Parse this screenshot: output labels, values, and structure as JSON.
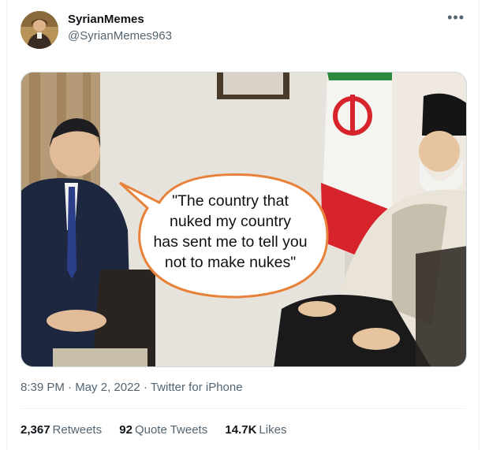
{
  "author": {
    "display_name": "SyrianMemes",
    "handle": "@SyrianMemes963",
    "avatar_icon": "user-avatar"
  },
  "more_icon": "more-options-icon",
  "image": {
    "caption_lines": [
      "\"The country that",
      "nuked my country",
      "has sent me to tell you",
      "not to make nukes\""
    ]
  },
  "meta": {
    "time": "8:39 PM",
    "sep1": " · ",
    "date": "May 2, 2022",
    "sep2": " · ",
    "source": "Twitter for iPhone"
  },
  "stats": {
    "retweets_count": "2,367",
    "retweets_label": "Retweets",
    "quotes_count": "92",
    "quotes_label": "Quote Tweets",
    "likes_count": "14.7K",
    "likes_label": "Likes"
  },
  "colors": {
    "accent": "#1d9bf0",
    "secondary_text": "#536471",
    "bubble_outline": "#e8823a"
  }
}
